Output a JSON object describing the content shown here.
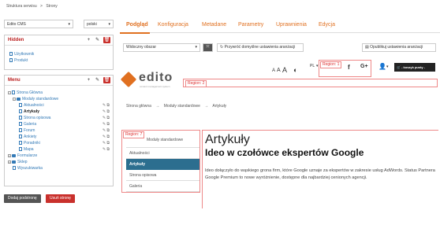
{
  "breadcrumb": {
    "item1": "Struktura serwisu",
    "sep": ">",
    "item2": "Strony"
  },
  "site_select": {
    "value": "Edito CMS"
  },
  "lang_select": {
    "value": "polski"
  },
  "hidden_panel": {
    "title": "Hidden",
    "items": [
      "Użytkownik",
      "Produkt"
    ]
  },
  "menu_panel": {
    "title": "Menu",
    "items": [
      "Strona Główna",
      "Moduły standardowe",
      "Aktualności",
      "Artykuły",
      "Strona opisowa",
      "Galeria",
      "Forum",
      "Ankiety",
      "Poradniki",
      "Mapa",
      "Formularze",
      "Sklep",
      "Wyszukiwarka"
    ]
  },
  "buttons": {
    "add_sub": "Dodaj podstronę",
    "delete": "Usuń stronę"
  },
  "tabs": [
    "Podgląd",
    "Konfiguracja",
    "Metadane",
    "Parametry",
    "Uprawnienia",
    "Edycja"
  ],
  "preview_toolbar": {
    "area_select": "Widoczny obszar",
    "restore": "Przywróć domyślne ustawienia aranżacji",
    "publish": "Opublikuj ustawienia aranżacji"
  },
  "preview": {
    "logo": "edito",
    "logo_sub": "content management system",
    "font_sizes": [
      "A",
      "A",
      "A"
    ],
    "lang": "PL",
    "region1": "Region: 1",
    "region2": "Region: 2",
    "region7": "Region: 7",
    "cart": "- koszyk pusty -",
    "crumbs": [
      "Strona główna",
      "Moduły standardowe",
      "Artykuły"
    ],
    "side_menu": [
      "Moduły standardowe",
      "Aktualności",
      "Artykuły",
      "Strona opisowa",
      "Galeria"
    ],
    "heading": "Artykuły",
    "subheading": "Ideo w czołówce ekspertów Google",
    "body": "Ideo dołączyło do wąskiego grona firm, które Google uznaje za ekspertów w zakresie usług AdWords. Status Partnera Google Premium to nowe wyróżnienie, dostępne dla najbardziej cenionych agencji."
  },
  "colors": {
    "accent": "#e07020",
    "link": "#337ab7",
    "danger": "#c9302c"
  }
}
